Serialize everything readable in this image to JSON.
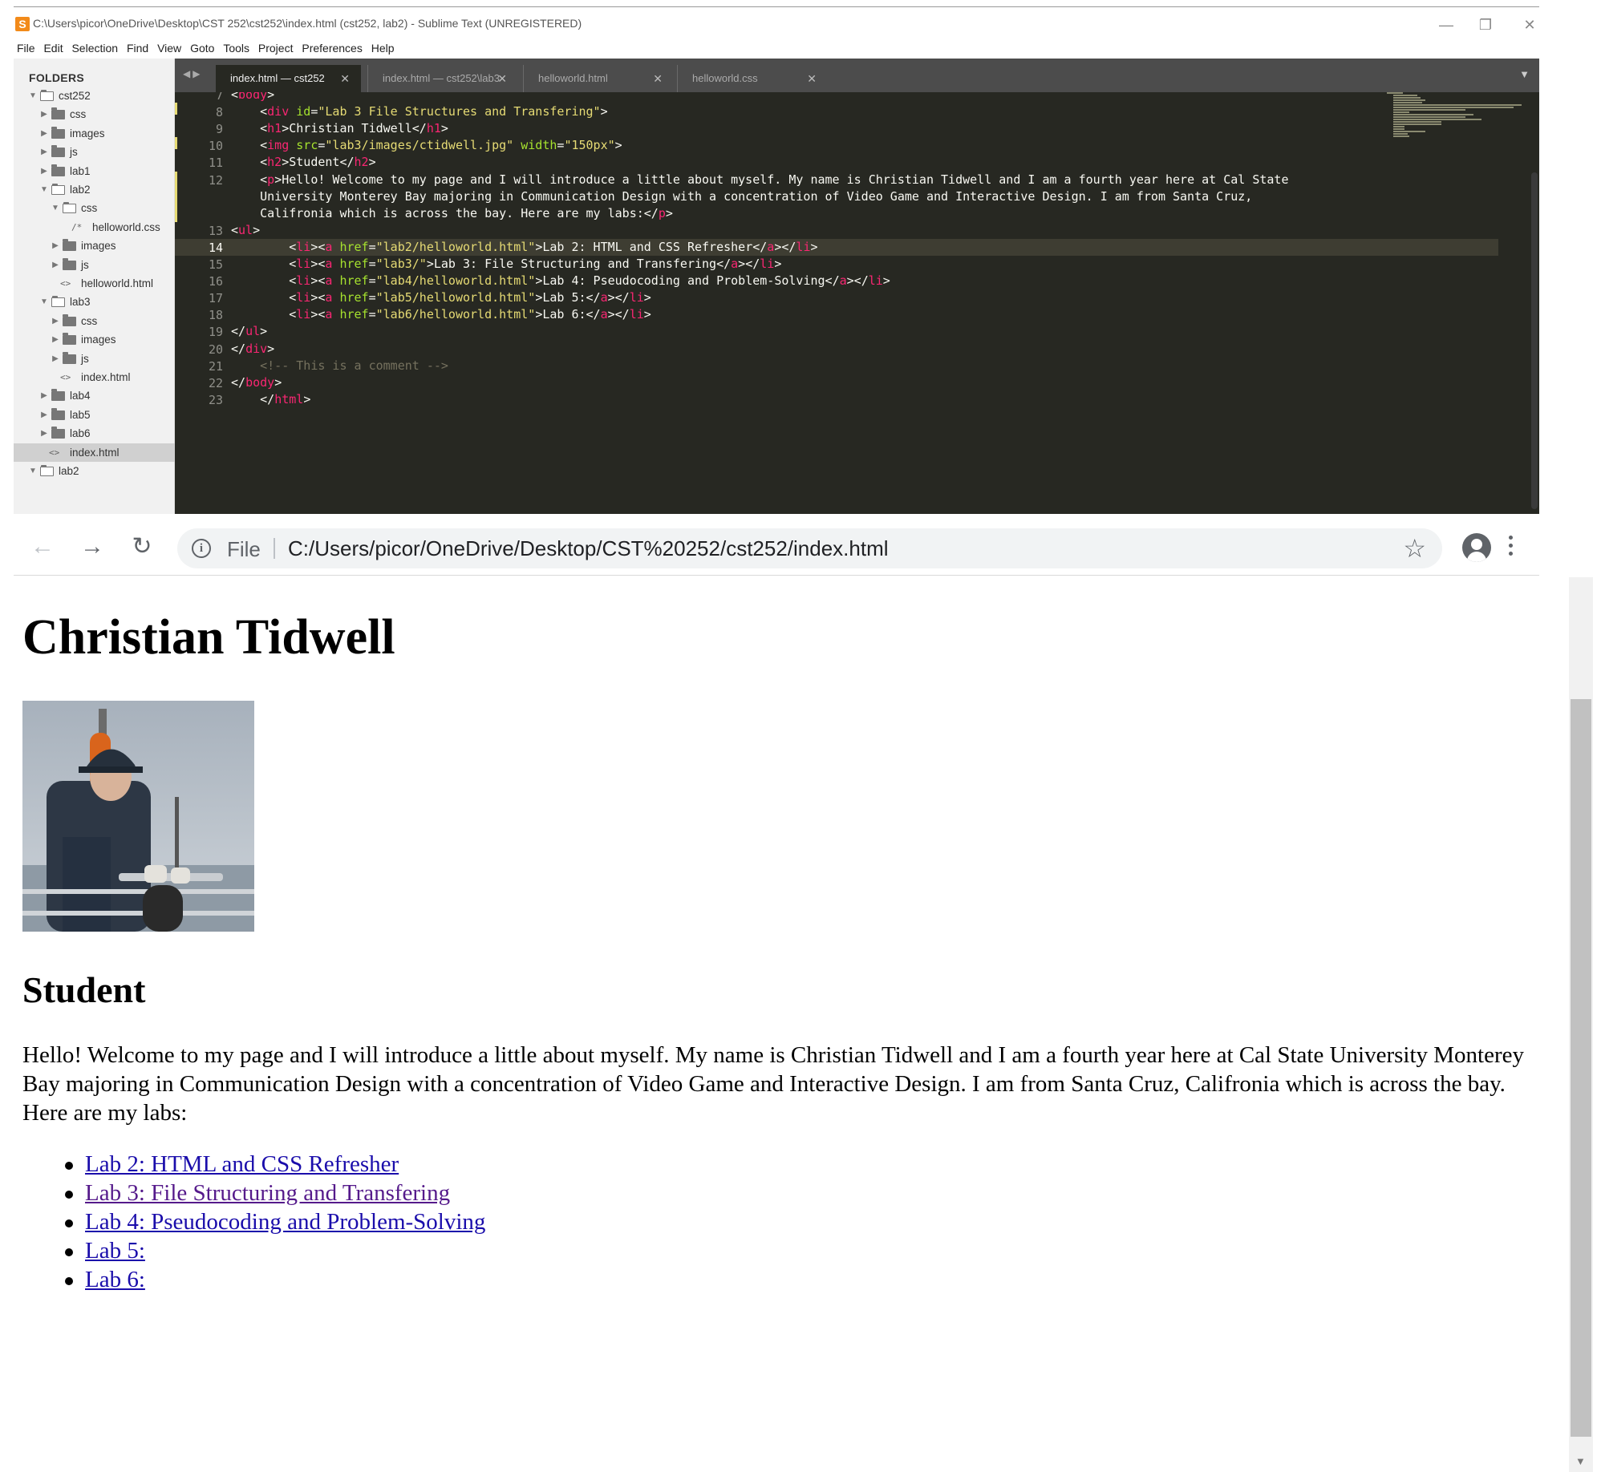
{
  "sublime": {
    "title": "C:\\Users\\picor\\OneDrive\\Desktop\\CST 252\\cst252\\index.html (cst252, lab2) - Sublime Text (UNREGISTERED)",
    "menu": [
      "File",
      "Edit",
      "Selection",
      "Find",
      "View",
      "Goto",
      "Tools",
      "Project",
      "Preferences",
      "Help"
    ],
    "sidebar": {
      "header": "FOLDERS",
      "tree": [
        {
          "label": "cst252",
          "kind": "folder",
          "open": true,
          "depth": 0
        },
        {
          "label": "css",
          "kind": "folder",
          "open": false,
          "depth": 1
        },
        {
          "label": "images",
          "kind": "folder",
          "open": false,
          "depth": 1
        },
        {
          "label": "js",
          "kind": "folder",
          "open": false,
          "depth": 1
        },
        {
          "label": "lab1",
          "kind": "folder",
          "open": false,
          "depth": 1
        },
        {
          "label": "lab2",
          "kind": "folder",
          "open": true,
          "depth": 1
        },
        {
          "label": "css",
          "kind": "folder",
          "open": true,
          "depth": 2
        },
        {
          "label": "helloworld.css",
          "kind": "css-file",
          "depth": 3
        },
        {
          "label": "images",
          "kind": "folder",
          "open": false,
          "depth": 2
        },
        {
          "label": "js",
          "kind": "folder",
          "open": false,
          "depth": 2
        },
        {
          "label": "helloworld.html",
          "kind": "html-file",
          "depth": 2
        },
        {
          "label": "lab3",
          "kind": "folder",
          "open": true,
          "depth": 1
        },
        {
          "label": "css",
          "kind": "folder",
          "open": false,
          "depth": 2
        },
        {
          "label": "images",
          "kind": "folder",
          "open": false,
          "depth": 2
        },
        {
          "label": "js",
          "kind": "folder",
          "open": false,
          "depth": 2
        },
        {
          "label": "index.html",
          "kind": "html-file",
          "depth": 2
        },
        {
          "label": "lab4",
          "kind": "folder",
          "open": false,
          "depth": 1
        },
        {
          "label": "lab5",
          "kind": "folder",
          "open": false,
          "depth": 1
        },
        {
          "label": "lab6",
          "kind": "folder",
          "open": false,
          "depth": 1
        },
        {
          "label": "index.html",
          "kind": "html-file",
          "depth": 1,
          "selected": true
        },
        {
          "label": "lab2",
          "kind": "folder",
          "open": true,
          "depth": 0
        }
      ]
    },
    "tabs": [
      {
        "label": "index.html — cst252",
        "active": true
      },
      {
        "label": "index.html — cst252\\lab3",
        "active": false
      },
      {
        "label": "helloworld.html",
        "active": false
      },
      {
        "label": "helloworld.css",
        "active": false
      }
    ],
    "current_line": 14,
    "code_lines": [
      {
        "n": "7",
        "text": "<body>"
      },
      {
        "n": "8",
        "text": "    <div id=\"Lab 3 File Structures and Transfering\">"
      },
      {
        "n": "9",
        "text": "    <h1>Christian Tidwell</h1>"
      },
      {
        "n": "10",
        "text": "    <img src=\"lab3/images/ctidwell.jpg\" width=\"150px\">"
      },
      {
        "n": "11",
        "text": "    <h2>Student</h2>"
      },
      {
        "n": "12",
        "text": "    <p>Hello! Welcome to my page and I will introduce a little about myself. My name is Christian Tidwell and I am a fourth year here at Cal State"
      },
      {
        "n": "",
        "text": "    University Monterey Bay majoring in Communication Design with a concentration of Video Game and Interactive Design. I am from Santa Cruz,"
      },
      {
        "n": "",
        "text": "    Califronia which is across the bay. Here are my labs:</p>"
      },
      {
        "n": "13",
        "text": "<ul>"
      },
      {
        "n": "14",
        "text": "        <li><a href=\"lab2/helloworld.html\">Lab 2: HTML and CSS Refresher</a></li>"
      },
      {
        "n": "15",
        "text": "        <li><a href=\"lab3/\">Lab 3: File Structuring and Transfering</a></li>"
      },
      {
        "n": "16",
        "text": "        <li><a href=\"lab4/helloworld.html\">Lab 4: Pseudocoding and Problem-Solving</a></li>"
      },
      {
        "n": "17",
        "text": "        <li><a href=\"lab5/helloworld.html\">Lab 5:</a></li>"
      },
      {
        "n": "18",
        "text": "        <li><a href=\"lab6/helloworld.html\">Lab 6:</a></li>"
      },
      {
        "n": "19",
        "text": "</ul>"
      },
      {
        "n": "20",
        "text": "</div>"
      },
      {
        "n": "21",
        "text": "    <!-- This is a comment -->"
      },
      {
        "n": "22",
        "text": "</body>"
      },
      {
        "n": "23",
        "text": "    </html>"
      }
    ]
  },
  "chrome": {
    "scheme_label": "File",
    "url": "C:/Users/picor/OneDrive/Desktop/CST%20252/cst252/index.html"
  },
  "page": {
    "h1": "Christian Tidwell",
    "photo_icon": "student-photo",
    "h2": "Student",
    "intro": "Hello! Welcome to my page and I will introduce a little about myself. My name is Christian Tidwell and I am a fourth year here at Cal State University Monterey Bay majoring in Communication Design with a concentration of Video Game and Interactive Design. I am from Santa Cruz, Califronia which is across the bay. Here are my labs:",
    "labs": [
      {
        "label": "Lab 2: HTML and CSS Refresher",
        "visited": false
      },
      {
        "label": "Lab 3: File Structuring and Transfering",
        "visited": true
      },
      {
        "label": "Lab 4: Pseudocoding and Problem-Solving",
        "visited": false
      },
      {
        "label": "Lab 5:",
        "visited": false
      },
      {
        "label": "Lab 6:",
        "visited": false
      }
    ]
  },
  "colors": {
    "editor_bg": "#272822",
    "tag": "#f92672",
    "attr": "#a6e22e",
    "string": "#e6db74",
    "comment": "#75715e",
    "link": "#1a0dab",
    "visited_link": "#551a8b"
  }
}
